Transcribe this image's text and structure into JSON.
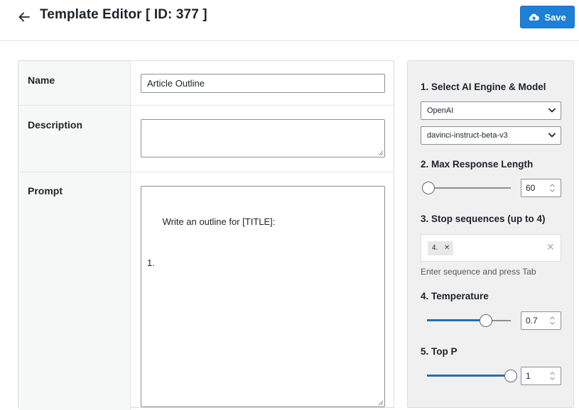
{
  "header": {
    "title": "Template Editor [ ID: 377 ]",
    "save_label": "Save"
  },
  "form": {
    "name_label": "Name",
    "name_value": "Article Outline",
    "description_label": "Description",
    "description_value": "",
    "prompt_label": "Prompt",
    "prompt_value": "Write an outline for [TITLE]:\n\n1."
  },
  "settings": {
    "engine_title": "1. Select AI Engine & Model",
    "engine_value": "OpenAI",
    "model_value": "davinci-instruct-beta-v3",
    "max_length_title": "2. Max Response Length",
    "max_length_value": "60",
    "max_length_fraction": 0.02,
    "stop_title": "3. Stop sequences (up to 4)",
    "stop_tags": [
      "4."
    ],
    "stop_hint": "Enter sequence and press Tab",
    "temperature_title": "4. Temperature",
    "temperature_value": "0.7",
    "temperature_fraction": 0.7,
    "top_p_title": "5. Top P",
    "top_p_value": "1",
    "top_p_fraction": 1.0
  },
  "icons": {
    "back": "arrow-left-icon",
    "save": "cloud-upload-icon",
    "dropdown": "chevron-down-icon",
    "tag_remove": "close-icon",
    "clear": "close-icon"
  },
  "colors": {
    "accent": "#1e7fd6",
    "slider_fill": "#2271b1"
  }
}
